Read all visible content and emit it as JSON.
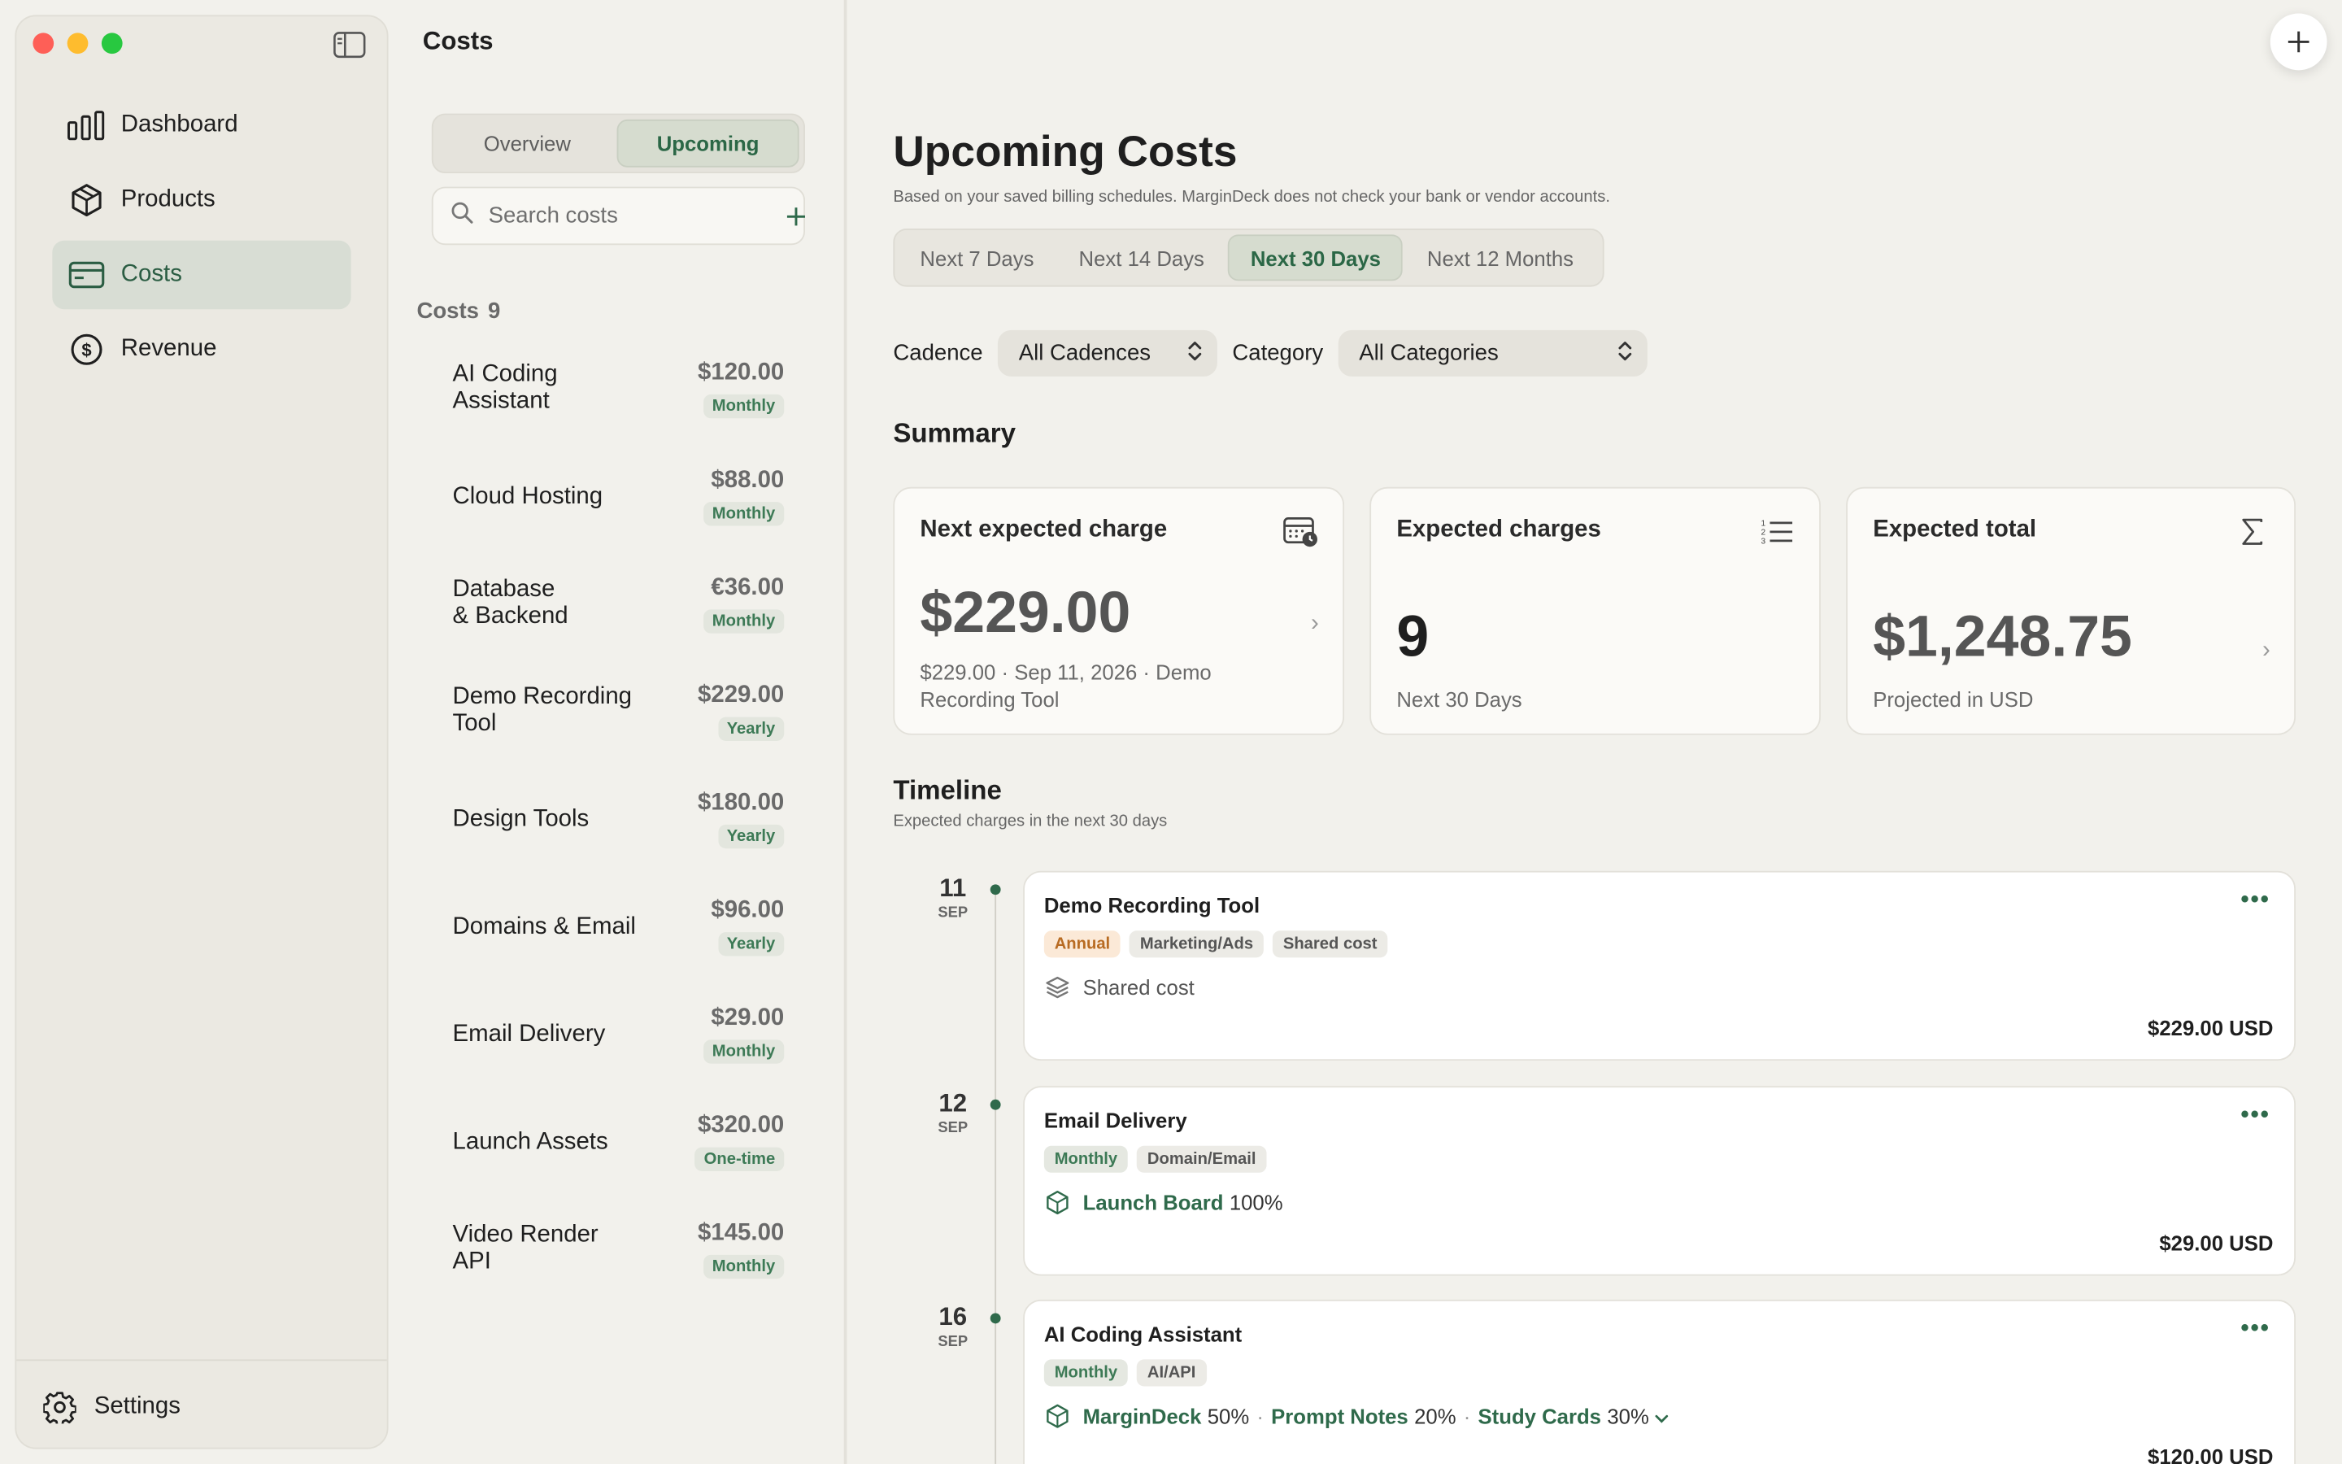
{
  "sidebar": {
    "items": [
      {
        "label": "Dashboard",
        "icon": "bar-chart-icon"
      },
      {
        "label": "Products",
        "icon": "box-icon"
      },
      {
        "label": "Costs",
        "icon": "card-icon",
        "active": true
      },
      {
        "label": "Revenue",
        "icon": "dollar-circle-icon"
      }
    ],
    "settings_label": "Settings"
  },
  "list": {
    "title": "Costs",
    "tabs": [
      "Overview",
      "Upcoming"
    ],
    "active_tab": "Upcoming",
    "search_placeholder": "Search costs",
    "heading": "Costs",
    "count": "9",
    "items": [
      {
        "name": "AI Coding Assistant",
        "line1": "AI Coding",
        "line2": "Assistant",
        "amount": "$120.00",
        "cadence": "Monthly"
      },
      {
        "name": "Cloud Hosting",
        "line1": "Cloud Hosting",
        "line2": "",
        "amount": "$88.00",
        "cadence": "Monthly"
      },
      {
        "name": "Database & Backend",
        "line1": "Database",
        "line2": "& Backend",
        "amount": "€36.00",
        "cadence": "Monthly"
      },
      {
        "name": "Demo Recording Tool",
        "line1": "Demo Recording",
        "line2": "Tool",
        "amount": "$229.00",
        "cadence": "Yearly"
      },
      {
        "name": "Design Tools",
        "line1": "Design Tools",
        "line2": "",
        "amount": "$180.00",
        "cadence": "Yearly"
      },
      {
        "name": "Domains & Email",
        "line1": "Domains & Email",
        "line2": "",
        "amount": "$96.00",
        "cadence": "Yearly"
      },
      {
        "name": "Email Delivery",
        "line1": "Email Delivery",
        "line2": "",
        "amount": "$29.00",
        "cadence": "Monthly"
      },
      {
        "name": "Launch Assets",
        "line1": "Launch Assets",
        "line2": "",
        "amount": "$320.00",
        "cadence": "One-time"
      },
      {
        "name": "Video Render API",
        "line1": "Video Render",
        "line2": "API",
        "amount": "$145.00",
        "cadence": "Monthly"
      }
    ]
  },
  "main": {
    "title": "Upcoming Costs",
    "subtitle": "Based on your saved billing schedules. MarginDeck does not check your bank or vendor accounts.",
    "ranges": [
      "Next 7 Days",
      "Next 14 Days",
      "Next 30 Days",
      "Next 12 Months"
    ],
    "active_range": "Next 30 Days",
    "filters": {
      "cadence_label": "Cadence",
      "cadence_value": "All Cadences",
      "category_label": "Category",
      "category_value": "All Categories"
    },
    "summary_title": "Summary",
    "cards": {
      "next": {
        "title": "Next expected charge",
        "value": "$229.00",
        "sub1": "$229.00 · Sep 11, 2026 · Demo",
        "sub2": "Recording Tool"
      },
      "count": {
        "title": "Expected charges",
        "value": "9",
        "sub": "Next 30 Days"
      },
      "total": {
        "title": "Expected total",
        "value": "$1,248.75",
        "sub": "Projected in USD"
      }
    },
    "timeline_title": "Timeline",
    "timeline_sub": "Expected charges in the next 30 days",
    "timeline": [
      {
        "day": "11",
        "month": "SEP",
        "name": "Demo Recording Tool",
        "tags": [
          {
            "label": "Annual",
            "kind": "annual"
          },
          {
            "label": "Marketing/Ads",
            "kind": "plain"
          },
          {
            "label": "Shared cost",
            "kind": "plain"
          }
        ],
        "alloc_text": "Shared cost",
        "amount": "$229.00 USD"
      },
      {
        "day": "12",
        "month": "SEP",
        "name": "Email Delivery",
        "tags": [
          {
            "label": "Monthly",
            "kind": "monthly"
          },
          {
            "label": "Domain/Email",
            "kind": "plain"
          }
        ],
        "alloc": [
          {
            "product": "Launch Board",
            "pct": "100%"
          }
        ],
        "amount": "$29.00 USD"
      },
      {
        "day": "16",
        "month": "SEP",
        "name": "AI Coding Assistant",
        "tags": [
          {
            "label": "Monthly",
            "kind": "monthly"
          },
          {
            "label": "AI/API",
            "kind": "plain"
          }
        ],
        "alloc": [
          {
            "product": "MarginDeck",
            "pct": "50%"
          },
          {
            "product": "Prompt Notes",
            "pct": "20%"
          },
          {
            "product": "Study Cards",
            "pct": "30%"
          }
        ],
        "amount": "$120.00 USD"
      }
    ]
  },
  "colors": {
    "accent": "#2f6a4b",
    "background": "#f2f1ec",
    "sidebar": "#ebe9e2"
  }
}
